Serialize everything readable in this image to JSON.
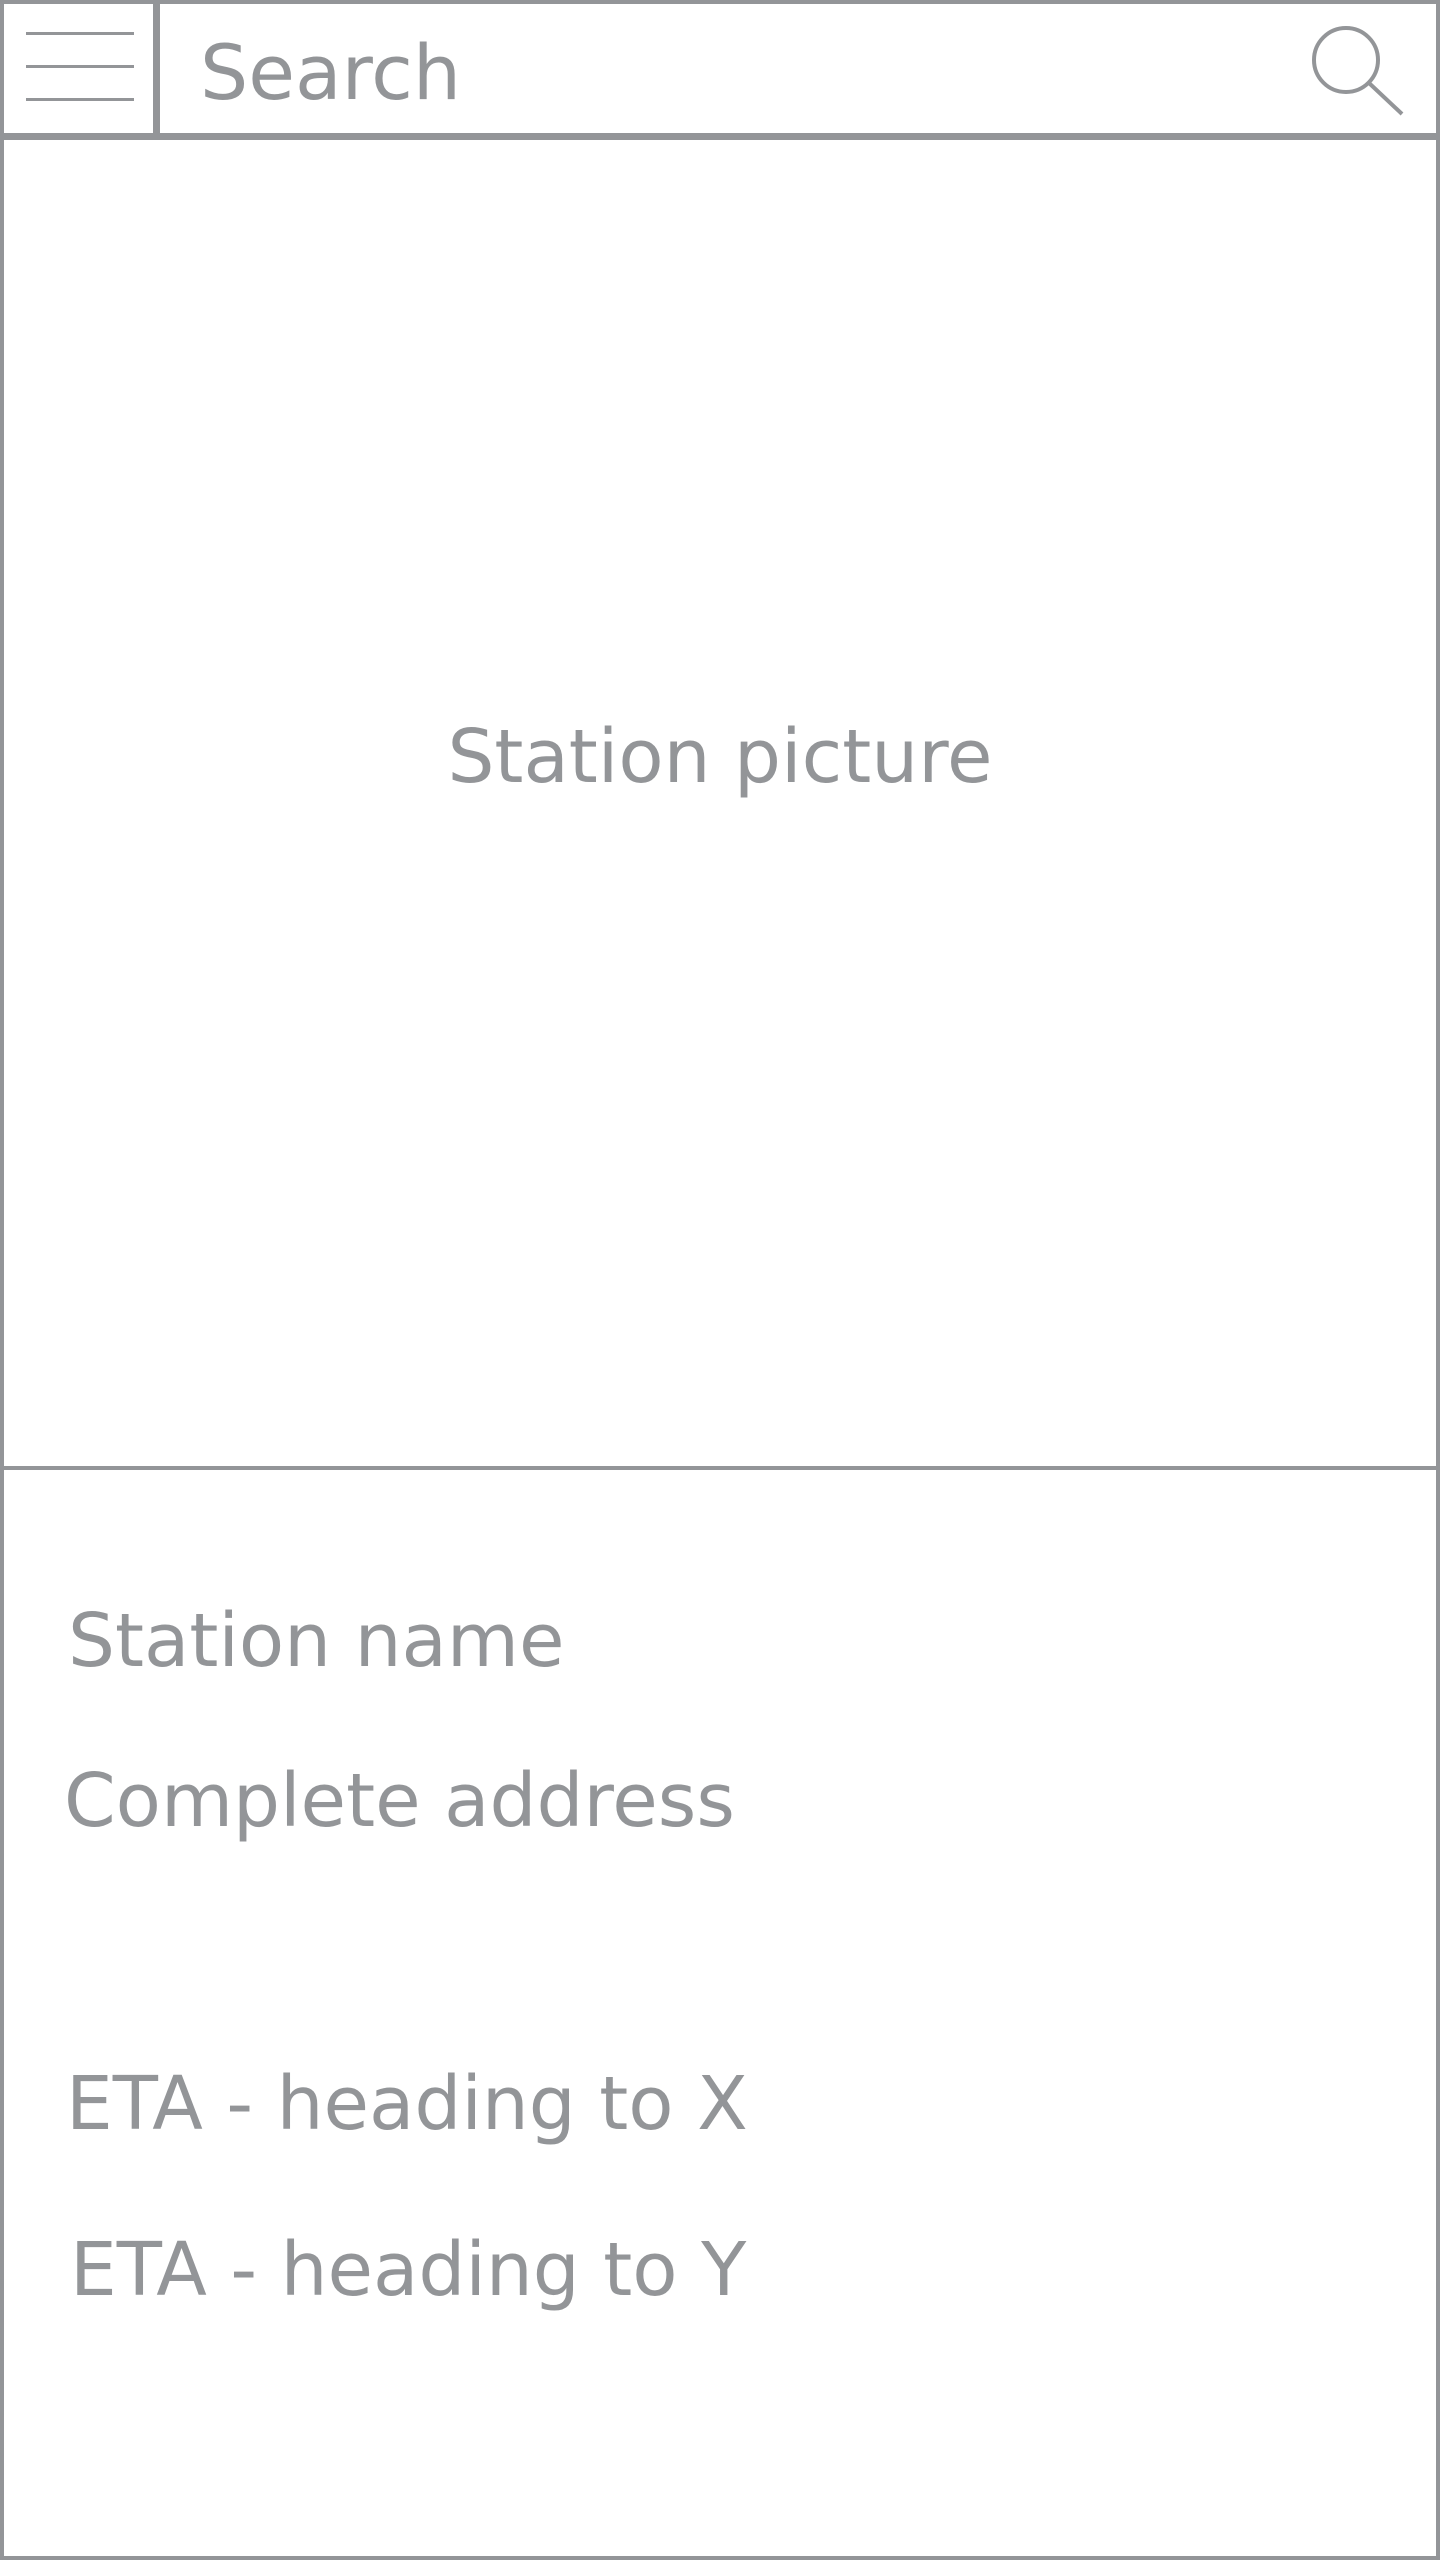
{
  "search": {
    "placeholder": "Search",
    "menu_icon": "hamburger-menu-icon",
    "search_icon": "search-icon"
  },
  "station_picture": {
    "label": "Station picture"
  },
  "station_info": {
    "name": "Station name",
    "address": "Complete address",
    "eta_x": "ETA - heading to X",
    "eta_y": "ETA - heading to Y"
  },
  "colors": {
    "wireframe": "#939598",
    "background": "#ffffff"
  }
}
